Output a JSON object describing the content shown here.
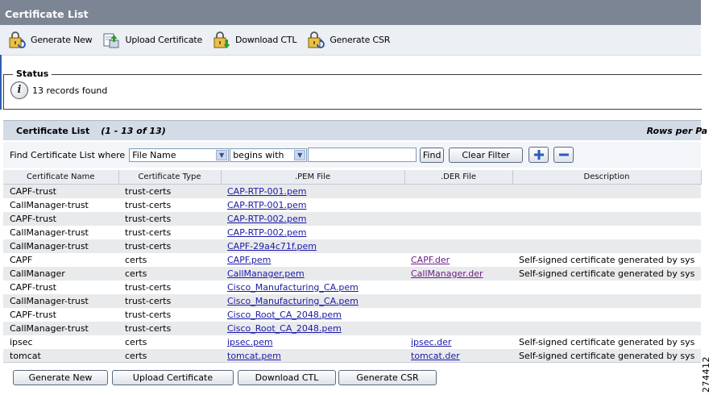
{
  "window": {
    "title": "Certificate List"
  },
  "toolbar": {
    "items": [
      {
        "label": "Generate New",
        "icon": "lock-refresh-icon"
      },
      {
        "label": "Upload Certificate",
        "icon": "upload-icon"
      },
      {
        "label": "Download CTL",
        "icon": "lock-download-icon"
      },
      {
        "label": "Generate CSR",
        "icon": "lock-refresh-icon"
      }
    ]
  },
  "status": {
    "legend": "Status",
    "icon": "info-icon",
    "message": "13 records found"
  },
  "list_header": {
    "title": "Certificate List",
    "count": "(1 - 13 of 13)",
    "rows_per_page": "Rows per Pa"
  },
  "filter": {
    "label": "Find Certificate List where",
    "field_value": "File Name",
    "operator_value": "begins with",
    "search_value": "",
    "find_label": "Find",
    "clear_label": "Clear Filter"
  },
  "table": {
    "columns": [
      "Certificate Name",
      "Certificate Type",
      ".PEM File",
      ".DER File",
      "Description"
    ],
    "rows": [
      {
        "name": "CAPF-trust",
        "type": "trust-certs",
        "pem": "CAP-RTP-001.pem",
        "der": "",
        "desc": ""
      },
      {
        "name": "CallManager-trust",
        "type": "trust-certs",
        "pem": "CAP-RTP-001.pem",
        "der": "",
        "desc": ""
      },
      {
        "name": "CAPF-trust",
        "type": "trust-certs",
        "pem": "CAP-RTP-002.pem",
        "der": "",
        "desc": ""
      },
      {
        "name": "CallManager-trust",
        "type": "trust-certs",
        "pem": "CAP-RTP-002.pem",
        "der": "",
        "desc": ""
      },
      {
        "name": "CallManager-trust",
        "type": "trust-certs",
        "pem": "CAPF-29a4c71f.pem",
        "der": "",
        "desc": ""
      },
      {
        "name": "CAPF",
        "type": "certs",
        "pem": "CAPF.pem",
        "der": "CAPF.der",
        "desc": "Self-signed certificate generated by sys"
      },
      {
        "name": "CallManager",
        "type": "certs",
        "pem": "CallManager.pem",
        "der": "CallManager.der",
        "desc": "Self-signed certificate generated by sys"
      },
      {
        "name": "CAPF-trust",
        "type": "trust-certs",
        "pem": "Cisco_Manufacturing_CA.pem",
        "der": "",
        "desc": ""
      },
      {
        "name": "CallManager-trust",
        "type": "trust-certs",
        "pem": "Cisco_Manufacturing_CA.pem",
        "der": "",
        "desc": ""
      },
      {
        "name": "CAPF-trust",
        "type": "trust-certs",
        "pem": "Cisco_Root_CA_2048.pem",
        "der": "",
        "desc": ""
      },
      {
        "name": "CallManager-trust",
        "type": "trust-certs",
        "pem": "Cisco_Root_CA_2048.pem",
        "der": "",
        "desc": ""
      },
      {
        "name": "ipsec",
        "type": "certs",
        "pem": "ipsec.pem",
        "der": "ipsec.der",
        "desc": "Self-signed certificate generated by sys"
      },
      {
        "name": "tomcat",
        "type": "certs",
        "pem": "tomcat.pem",
        "der": "tomcat.der",
        "desc": "Self-signed certificate generated by sys"
      }
    ]
  },
  "bottom_buttons": [
    "Generate New",
    "Upload Certificate",
    "Download CTL",
    "Generate CSR"
  ],
  "figure_id": "274412"
}
